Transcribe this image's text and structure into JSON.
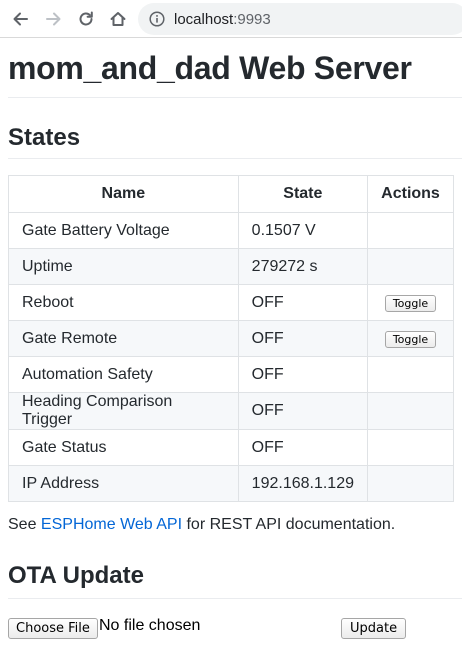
{
  "browser": {
    "url_host": "localhost",
    "url_port": ":9993"
  },
  "page": {
    "title": "mom_and_dad Web Server",
    "states_heading": "States",
    "table": {
      "headers": [
        "Name",
        "State",
        "Actions"
      ],
      "rows": [
        {
          "name": "Gate Battery Voltage",
          "state": "0.1507 V",
          "action": ""
        },
        {
          "name": "Uptime",
          "state": "279272 s",
          "action": ""
        },
        {
          "name": "Reboot",
          "state": "OFF",
          "action": "Toggle"
        },
        {
          "name": "Gate Remote",
          "state": "OFF",
          "action": "Toggle"
        },
        {
          "name": "Automation Safety",
          "state": "OFF",
          "action": ""
        },
        {
          "name": "Heading Comparison Trigger",
          "state": "OFF",
          "action": ""
        },
        {
          "name": "Gate Status",
          "state": "OFF",
          "action": ""
        },
        {
          "name": "IP Address",
          "state": "192.168.1.129",
          "action": ""
        }
      ]
    },
    "api_note": {
      "prefix": "See ",
      "link_text": "ESPHome Web API",
      "suffix": " for REST API documentation."
    },
    "ota": {
      "heading": "OTA Update",
      "choose_file_label": "Choose File",
      "file_status": "No file chosen",
      "update_label": "Update"
    }
  },
  "colors": {
    "link": "#0366d6",
    "row_stripe": "#f6f8fa",
    "border": "#dfe2e5"
  },
  "icons": {
    "back": "arrow-left-icon",
    "forward": "arrow-right-icon",
    "reload": "reload-icon",
    "home": "home-icon",
    "info": "info-icon"
  }
}
